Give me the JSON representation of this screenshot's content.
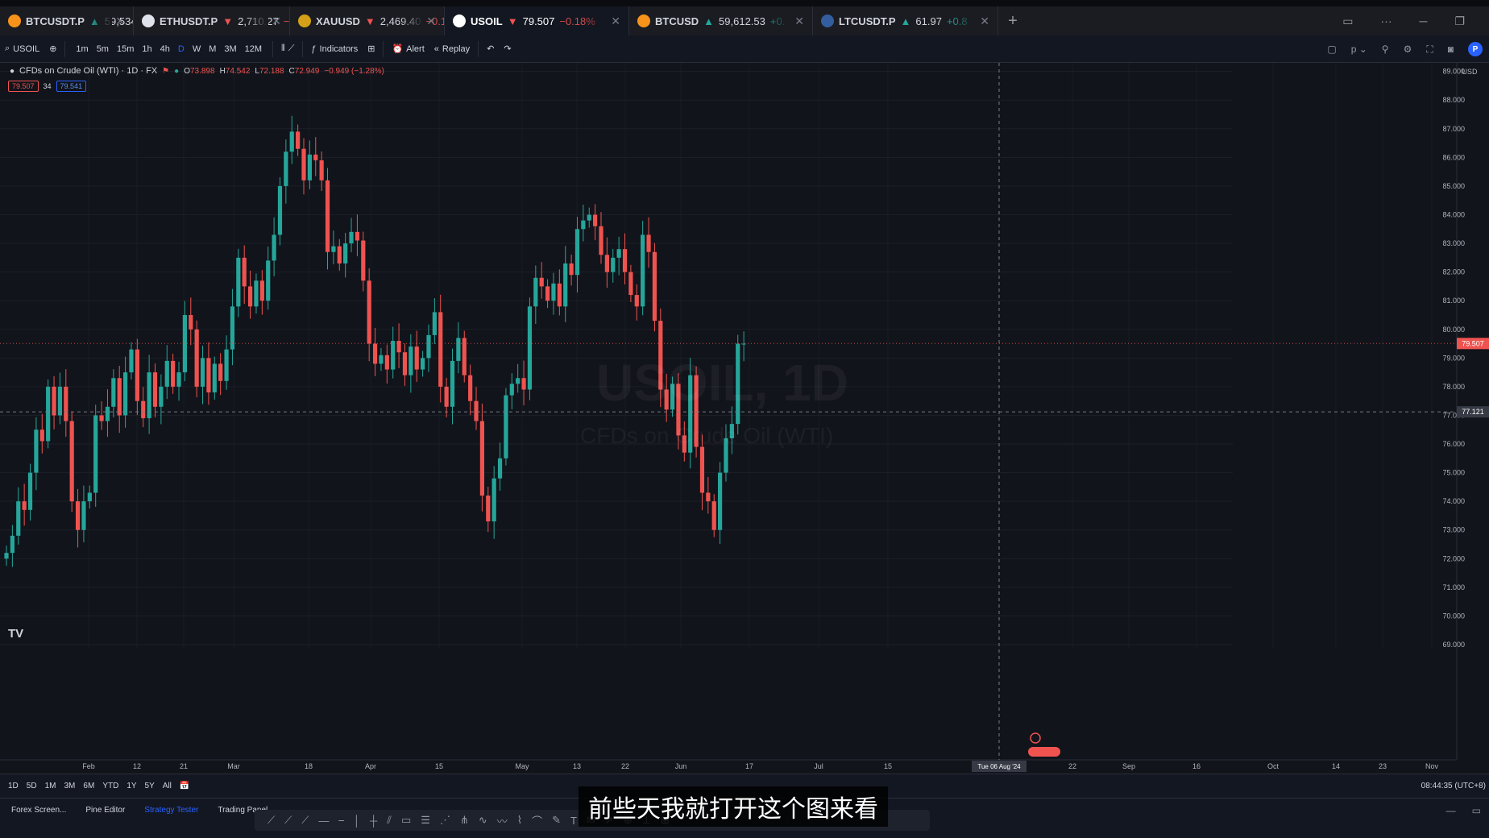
{
  "tabs": [
    {
      "symbol": "BTCUSDT.P",
      "dir": "up",
      "arrow": "▲",
      "price": "59,534.0",
      "change": "+0",
      "icon_color": "#f7931a",
      "icon": "bitcoin-icon",
      "active": false,
      "width": 166
    },
    {
      "symbol": "ETHUSDT.P",
      "dir": "dn",
      "arrow": "▼",
      "price": "2,710.27",
      "change": "−0",
      "icon_color": "#e0e3eb",
      "icon": "ethereum-icon",
      "active": false,
      "width": 194
    },
    {
      "symbol": "XAUUSD",
      "dir": "dn",
      "arrow": "▼",
      "price": "2,469.40",
      "change": "−0.1",
      "icon_color": "#d4a017",
      "icon": "gold-icon",
      "active": false,
      "width": 192
    },
    {
      "symbol": "USOIL",
      "dir": "dn",
      "arrow": "▼",
      "price": "79.507",
      "change": "−0.18%",
      "icon_color": "#ffffff",
      "icon": "oil-drop-icon",
      "active": true,
      "width": 229
    },
    {
      "symbol": "BTCUSD",
      "dir": "up",
      "arrow": "▲",
      "price": "59,612.53",
      "change": "+0.",
      "icon_color": "#f7931a",
      "icon": "bitcoin-icon",
      "active": false,
      "width": 228
    },
    {
      "symbol": "LTCUSDT.P",
      "dir": "up",
      "arrow": "▲",
      "price": "61.97",
      "change": "+0.8",
      "icon_color": "#345d9d",
      "icon": "litecoin-icon",
      "active": false,
      "width": 230
    }
  ],
  "toolbar": {
    "symbol_search": "USOIL",
    "intervals": [
      "1m",
      "5m",
      "15m",
      "1h",
      "4h",
      "D",
      "W",
      "M",
      "3M",
      "12M"
    ],
    "active_interval": "D",
    "indicators_label": "Indicators",
    "alert_label": "Alert",
    "replay_label": "Replay",
    "publish_label": "P"
  },
  "legend": {
    "title": "CFDs on Crude Oil (WTI) · 1D · FX",
    "o_label": "O",
    "o": "73.898",
    "h_label": "H",
    "h": "74.542",
    "l_label": "L",
    "l": "72.188",
    "c_label": "C",
    "c": "72.949",
    "change": "−0.949 (−1.28%)",
    "price_box": "79.507",
    "spread": "34",
    "price_box2": "79.541"
  },
  "watermark": {
    "line1": "USOIL, 1D",
    "line2": "CFDs on Crude Oil (WTI)"
  },
  "tv_logo": "TV",
  "axis": {
    "currency": "USD",
    "current_price_label": "79.507",
    "crosshair_price_label": "77.121",
    "crosshair_date_label": "Tue 06 Aug '24"
  },
  "range_bar": {
    "ranges": [
      "1D",
      "5D",
      "1M",
      "3M",
      "6M",
      "YTD",
      "1Y",
      "5Y",
      "All"
    ],
    "clock": "08:44:35 (UTC+8)"
  },
  "bottom_tabs": [
    "Forex Screen...",
    "Pine Editor",
    "Strategy Tester",
    "Trading Panel"
  ],
  "bottom_active": "Strategy Tester",
  "subtitle": "前些天我就打开这个图来看",
  "chart_data": {
    "type": "candlestick",
    "title": "CFDs on Crude Oil (WTI) · 1D · FX",
    "ylim": [
      69,
      89.3
    ],
    "yticks": [
      69,
      70,
      71,
      72,
      73,
      74,
      75,
      76,
      77,
      78,
      79,
      80,
      81,
      82,
      83,
      84,
      85,
      86,
      87,
      88,
      89
    ],
    "x_ticks": [
      "Feb",
      "12",
      "21",
      "Mar",
      "18",
      "Apr",
      "15",
      "May",
      "13",
      "22",
      "Jun",
      "17",
      "Jul",
      "15",
      "22",
      "Sep",
      "16",
      "Oct",
      "14",
      "23",
      "Nov"
    ],
    "current_price": 79.507,
    "crosshair_price": 77.121,
    "up_color": "#26a69a",
    "down_color": "#ef5350",
    "closes": [
      72.2,
      72.8,
      74.0,
      73.7,
      75.0,
      76.5,
      76.1,
      78.0,
      77.0,
      78.0,
      76.8,
      74.0,
      73.0,
      74.0,
      74.3,
      77.0,
      76.8,
      77.3,
      78.3,
      77.0,
      78.5,
      79.3,
      77.5,
      76.9,
      78.5,
      77.3,
      78.0,
      78.9,
      78.0,
      78.5,
      80.5,
      80.0,
      78.0,
      79.0,
      77.8,
      78.8,
      78.2,
      79.3,
      80.8,
      82.5,
      81.5,
      80.8,
      81.7,
      81.0,
      82.4,
      83.3,
      85.0,
      86.2,
      86.9,
      86.3,
      85.2,
      86.1,
      85.9,
      85.2,
      82.7,
      82.9,
      82.3,
      83.0,
      83.4,
      83.1,
      81.7,
      79.5,
      78.8,
      79.1,
      78.6,
      79.6,
      79.2,
      78.4,
      79.4,
      78.6,
      79.0,
      79.8,
      80.6,
      78.0,
      77.3,
      78.9,
      79.7,
      78.4,
      77.5,
      76.8,
      74.2,
      73.3,
      74.8,
      75.5,
      77.7,
      78.1,
      78.3,
      77.9,
      80.8,
      81.8,
      81.5,
      81.0,
      81.6,
      80.8,
      82.3,
      81.9,
      83.5,
      83.8,
      84.0,
      83.6,
      82.6,
      82.0,
      82.5,
      82.8,
      82.0,
      81.2,
      80.8,
      83.3,
      82.7,
      80.3,
      77.9,
      77.2,
      78.1,
      76.3,
      75.7,
      78.4,
      75.9,
      74.3,
      74.0,
      73.0,
      75.0,
      76.2,
      76.7,
      79.5,
      79.5
    ]
  }
}
